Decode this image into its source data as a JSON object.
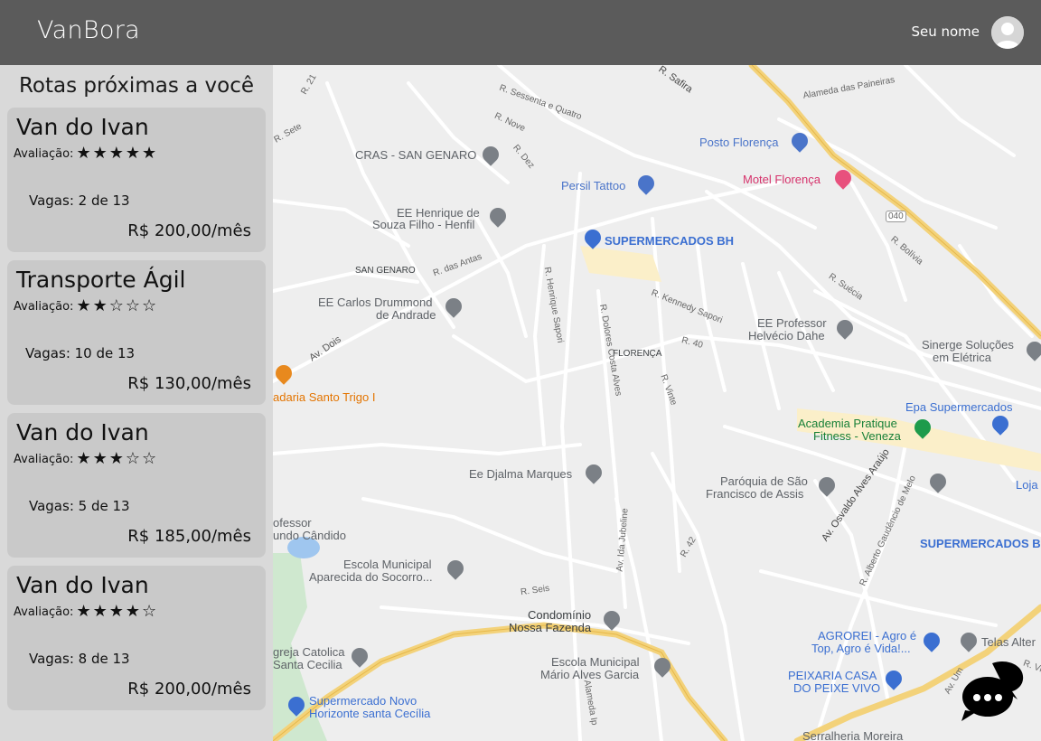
{
  "header": {
    "brand": "VanBora",
    "user_name": "Seu nome"
  },
  "sidebar": {
    "title": "Rotas próximas a você",
    "rating_label": "Avaliação:",
    "routes": [
      {
        "name": "Van do Ivan",
        "rating": 5,
        "stars": "★★★★★",
        "vacancies": "Vagas: 2 de 13",
        "price": "R$ 200,00/mês"
      },
      {
        "name": "Transporte Ágil",
        "rating": 2,
        "stars": "★★☆☆☆",
        "vacancies": "Vagas: 10 de 13",
        "price": "R$ 130,00/mês"
      },
      {
        "name": "Van do Ivan",
        "rating": 3,
        "stars": "★★★☆☆",
        "vacancies": "Vagas: 5 de 13",
        "price": "R$ 185,00/mês"
      },
      {
        "name": "Van do Ivan",
        "rating": 4,
        "stars": "★★★★☆",
        "vacancies": "Vagas: 8 de 13",
        "price": "R$ 200,00/mês"
      }
    ]
  },
  "map": {
    "pois": [
      {
        "text": "CRAS - SAN GENARO",
        "color": "#5f6368"
      },
      {
        "text": "Posto Florença",
        "color": "#4a74c9"
      },
      {
        "text": "Motel Florença",
        "color": "#d6336c"
      },
      {
        "text": "Persil Tattoo",
        "color": "#4a74c9"
      },
      {
        "text": "EE Henrique de",
        "color": "#5f6368"
      },
      {
        "text": "Souza Filho - Henfil",
        "color": "#5f6368"
      },
      {
        "text": "SUPERMERCADOS BH",
        "color": "#3b6fd1"
      },
      {
        "text": "EE Carlos Drummond",
        "color": "#5f6368"
      },
      {
        "text": "de Andrade",
        "color": "#5f6368"
      },
      {
        "text": "EE Professor",
        "color": "#5f6368"
      },
      {
        "text": "Helvécio Dahe",
        "color": "#5f6368"
      },
      {
        "text": "Sinerge Soluções",
        "color": "#5f6368"
      },
      {
        "text": "em Elétrica",
        "color": "#5f6368"
      },
      {
        "text": "adaria Santo Trigo I",
        "color": "#e37400"
      },
      {
        "text": "Epa Supermercados",
        "color": "#3b6fd1"
      },
      {
        "text": "Academia Pratique",
        "color": "#188038"
      },
      {
        "text": "Fitness - Veneza",
        "color": "#188038"
      },
      {
        "text": "Ee Djalma Marques",
        "color": "#5f6368"
      },
      {
        "text": "Paróquia de São",
        "color": "#5f6368"
      },
      {
        "text": "Francisco de Assis",
        "color": "#5f6368"
      },
      {
        "text": "Loja",
        "color": "#3b6fd1"
      },
      {
        "text": "SUPERMERCADOS B",
        "color": "#3b6fd1"
      },
      {
        "text": "ofessor",
        "color": "#5f6368"
      },
      {
        "text": "undo Cândido",
        "color": "#5f6368"
      },
      {
        "text": "Escola Municipal",
        "color": "#5f6368"
      },
      {
        "text": "Aparecida do Socorro...",
        "color": "#5f6368"
      },
      {
        "text": "Condomínio",
        "color": "#3c4043"
      },
      {
        "text": "Nossa Fazenda",
        "color": "#3c4043"
      },
      {
        "text": "AGROREI - Agro é",
        "color": "#3b6fd1"
      },
      {
        "text": "Top, Agro é Vida!...",
        "color": "#3b6fd1"
      },
      {
        "text": "Telas Alter",
        "color": "#5f6368"
      },
      {
        "text": "greja Catolica",
        "color": "#5f6368"
      },
      {
        "text": "Santa Cecilia",
        "color": "#5f6368"
      },
      {
        "text": "Escola Municipal",
        "color": "#5f6368"
      },
      {
        "text": "Mário Alves Garcia",
        "color": "#5f6368"
      },
      {
        "text": "PEIXARIA CASA",
        "color": "#3b6fd1"
      },
      {
        "text": "DO PEIXE VIVO",
        "color": "#3b6fd1"
      },
      {
        "text": "Supermercado Novo",
        "color": "#3b6fd1"
      },
      {
        "text": "Horizonte santa Cecília",
        "color": "#3b6fd1"
      },
      {
        "text": "Serralheria Moreira",
        "color": "#5f6368"
      },
      {
        "text": "FLORENÇA",
        "color": "#3c4043"
      },
      {
        "text": "SAN GENARO",
        "color": "#3c4043"
      }
    ],
    "streets": [
      "R. Sessenta e Quatro",
      "R. Nove",
      "R. Dez",
      "R. das Antas",
      "Av. Dois",
      "R. Henrique Sapori",
      "R. Dolores Costa Alves",
      "R. Kennedy Sapori",
      "R. 40",
      "R. Vinte",
      "R. Sete",
      "R. Seis",
      "Av. Osvaldo Alves Araújo",
      "R. Alberto Gaudêncio de Melo",
      "R. 42",
      "Av. Ida Jubeline",
      "Alameda das Paineiras",
      "R. Safira",
      "R. Bolívia",
      "R. Suécia",
      "040",
      "R. 21",
      "Alameda Ip",
      "Av. Um",
      "R. Vi"
    ]
  },
  "chat": {
    "icon": "chat-icon"
  }
}
